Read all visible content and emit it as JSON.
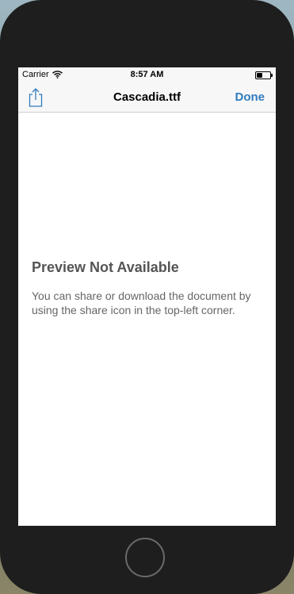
{
  "status_bar": {
    "carrier": "Carrier",
    "time": "8:57 AM"
  },
  "nav": {
    "title": "Cascadia.ttf",
    "done_label": "Done",
    "share_icon": "share-icon"
  },
  "preview": {
    "title": "Preview Not Available",
    "description": "You can share or download the document by using the share icon in the top-left corner."
  },
  "colors": {
    "accent": "#2f7bbf",
    "device": "#1e1e1e",
    "bar_background": "#f7f7f7"
  }
}
